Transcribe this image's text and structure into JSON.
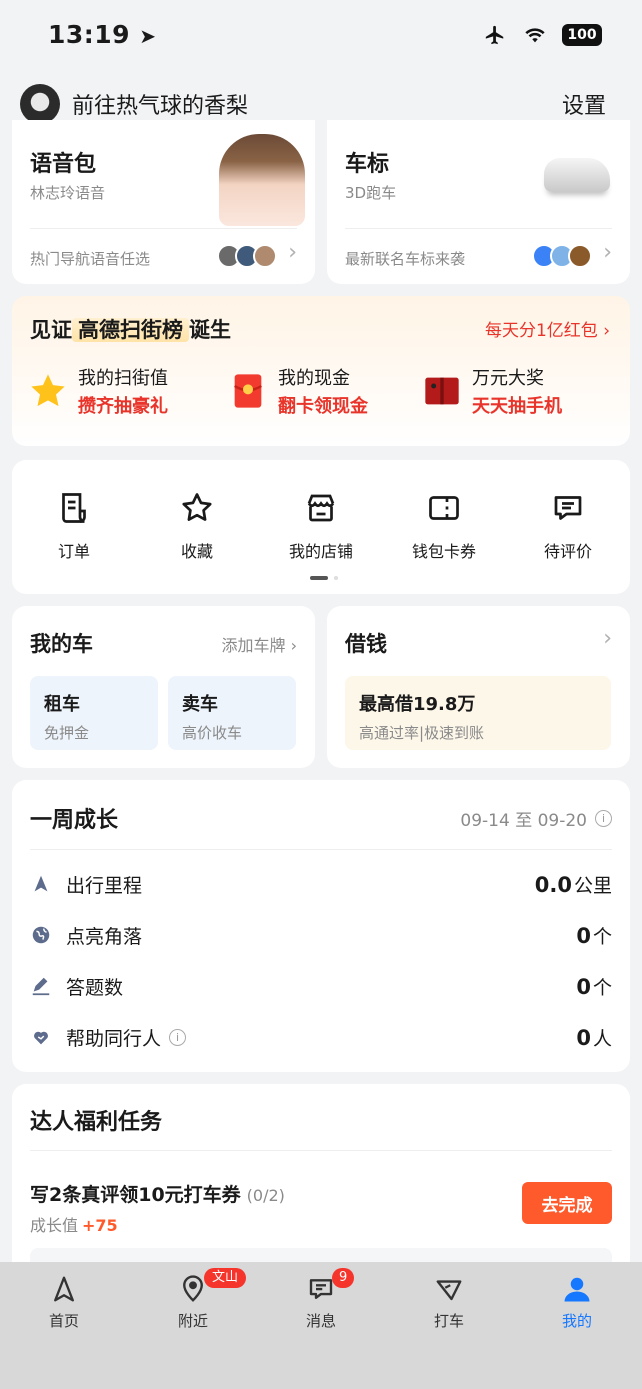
{
  "status_bar": {
    "time": "13:19",
    "battery": "100"
  },
  "header": {
    "username": "前往热气球的香梨",
    "settings_label": "设置"
  },
  "voice_card": {
    "title": "语音包",
    "subtitle": "林志玲语音",
    "footer": "热门导航语音任选"
  },
  "car_card": {
    "title": "车标",
    "subtitle": "3D跑车",
    "footer": "最新联名车标来袭"
  },
  "promo": {
    "title_pre": "见证",
    "title_highlight": "高德扫街榜",
    "title_post": "诞生",
    "right_link": "每天分1亿红包",
    "items": [
      {
        "line1": "我的扫街值",
        "line2": "攒齐抽豪礼",
        "icon": "star-icon"
      },
      {
        "line1": "我的现金",
        "line2": "翻卡领现金",
        "icon": "red-envelope-icon"
      },
      {
        "line1": "万元大奖",
        "line2": "天天抽手机",
        "icon": "phone-prize-icon"
      }
    ]
  },
  "shortcuts": [
    {
      "label": "订单",
      "icon": "order-icon"
    },
    {
      "label": "收藏",
      "icon": "star-outline-icon"
    },
    {
      "label": "我的店铺",
      "icon": "shop-icon"
    },
    {
      "label": "钱包卡券",
      "icon": "wallet-icon"
    },
    {
      "label": "待评价",
      "icon": "review-icon"
    }
  ],
  "my_car": {
    "title": "我的车",
    "add_plate": "添加车牌",
    "rent": {
      "title": "租车",
      "sub": "免押金"
    },
    "sell": {
      "title": "卖车",
      "sub": "高价收车"
    }
  },
  "borrow": {
    "title": "借钱",
    "box_title": "最高借19.8万",
    "box_sub": "高通过率|极速到账"
  },
  "growth": {
    "title": "一周成长",
    "range": "09-14 至 09-20",
    "rows": [
      {
        "label": "出行里程",
        "value": "0.0",
        "unit": "公里",
        "icon": "navigation-icon"
      },
      {
        "label": "点亮角落",
        "value": "0",
        "unit": "个",
        "icon": "globe-icon"
      },
      {
        "label": "答题数",
        "value": "0",
        "unit": "个",
        "icon": "pen-icon"
      },
      {
        "label": "帮助同行人",
        "value": "0",
        "unit": "人",
        "icon": "heart-hand-icon"
      }
    ]
  },
  "tasks": {
    "title": "达人福利任务",
    "task_name": "写2条真评领10元打车券",
    "task_progress": "(0/2)",
    "reward_label": "成长值",
    "reward_value": "+75",
    "button": "去完成"
  },
  "tabbar": {
    "tabs": [
      {
        "label": "首页",
        "icon": "home-arrow-icon"
      },
      {
        "label": "附近",
        "icon": "location-pin-icon",
        "badge": "文山"
      },
      {
        "label": "消息",
        "icon": "message-icon",
        "badge": "9"
      },
      {
        "label": "打车",
        "icon": "taxi-icon"
      },
      {
        "label": "我的",
        "icon": "profile-icon",
        "active": true
      }
    ]
  }
}
